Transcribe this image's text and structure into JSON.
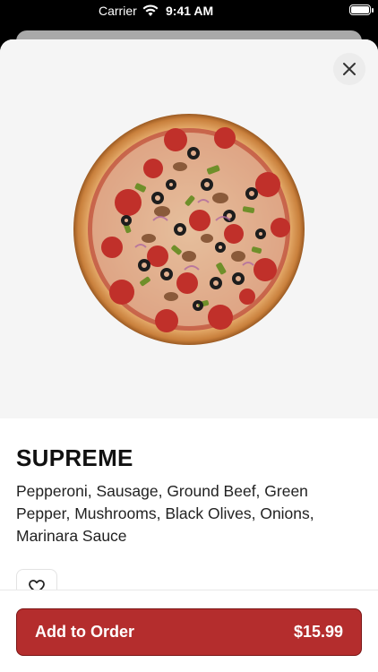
{
  "status_bar": {
    "carrier": "Carrier",
    "time": "9:41 AM",
    "icons": [
      "wifi-icon",
      "battery-icon"
    ]
  },
  "item": {
    "name": "SUPREME",
    "description": "Pepperoni, Sausage, Ground Beef, Green Pepper, Mushrooms, Black Olives, Onions, Marinara Sauce",
    "image_icon": "pizza-image"
  },
  "actions": {
    "close_icon": "close-icon",
    "favorite_icon": "heart-icon",
    "add_label": "Add to Order",
    "price": "$15.99"
  },
  "colors": {
    "accent": "#b42d2d",
    "hero_background": "#f5f5f5"
  }
}
